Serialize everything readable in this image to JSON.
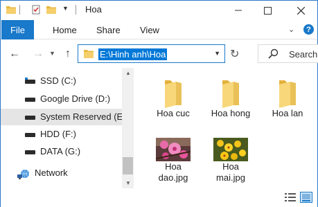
{
  "titlebar": {
    "title": "Hoa",
    "qat_dropdown_icon": "caret-down-icon",
    "minimize_icon": "minimize-icon",
    "maximize_icon": "maximize-icon",
    "close_icon": "close-icon"
  },
  "ribbon": {
    "tabs": [
      {
        "label": "File"
      },
      {
        "label": "Home"
      },
      {
        "label": "Share"
      },
      {
        "label": "View"
      }
    ],
    "help_label": "?"
  },
  "navbar": {
    "address": "E:\\Hinh anh\\Hoa",
    "search_label": "Search"
  },
  "sidebar": {
    "items": [
      {
        "label": "SSD (C:)",
        "icon": "ssd-drive-icon",
        "selected": false
      },
      {
        "label": "Google Drive (D:)",
        "icon": "drive-icon",
        "selected": false
      },
      {
        "label": "System Reserved (E:)",
        "icon": "drive-icon",
        "selected": true
      },
      {
        "label": "HDD (F:)",
        "icon": "drive-icon",
        "selected": false
      },
      {
        "label": "DATA (G:)",
        "icon": "drive-icon",
        "selected": false
      }
    ],
    "network_label": "Network"
  },
  "content": {
    "folders": [
      {
        "name": "Hoa cuc"
      },
      {
        "name": "Hoa hong"
      },
      {
        "name": "Hoa lan"
      }
    ],
    "files": [
      {
        "line1": "Hoa",
        "line2": "dao.jpg"
      },
      {
        "line1": "Hoa",
        "line2": "mai.jpg"
      }
    ]
  },
  "colors": {
    "accent": "#1979ca",
    "selection": "#0078d7",
    "folder": "#f5cf6b",
    "sidebar_selected": "#e5e5e5"
  }
}
